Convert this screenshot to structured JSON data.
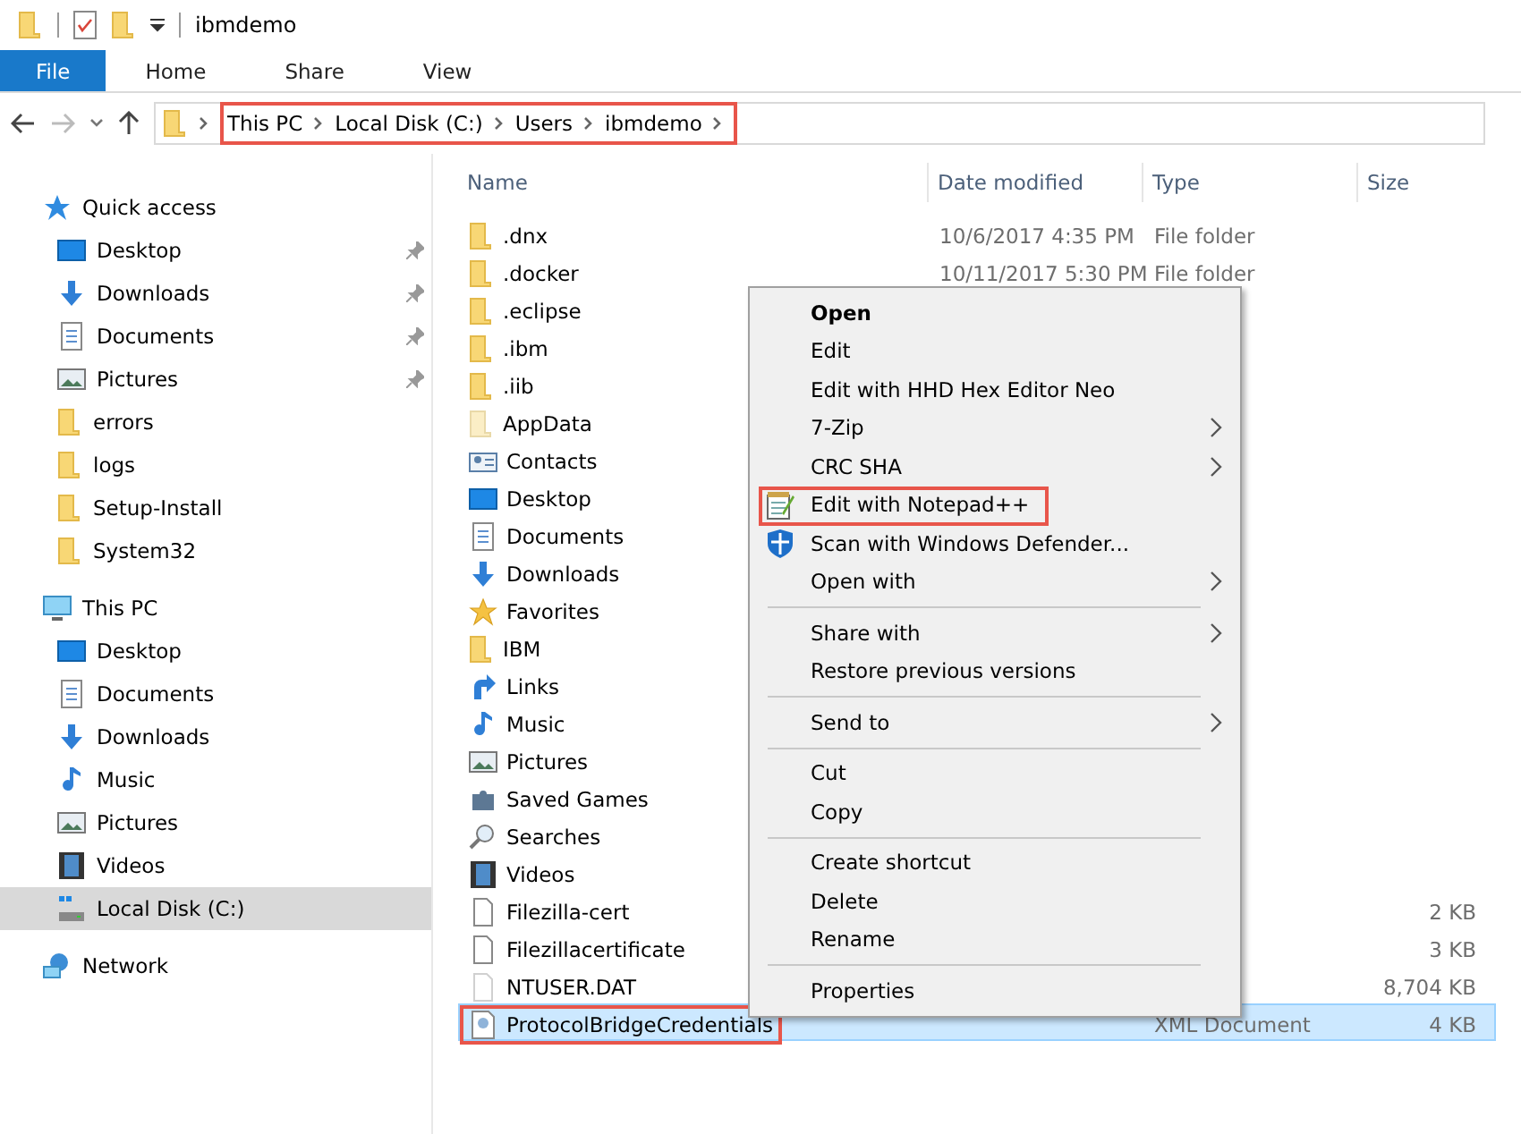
{
  "window": {
    "title": "ibmdemo"
  },
  "ribbon_tabs": [
    {
      "label": "File",
      "selected": true
    },
    {
      "label": "Home",
      "selected": false
    },
    {
      "label": "Share",
      "selected": false
    },
    {
      "label": "View",
      "selected": false
    }
  ],
  "address_bar": {
    "highlighted": true,
    "breadcrumbs": [
      "This PC",
      "Local Disk (C:)",
      "Users",
      "ibmdemo"
    ]
  },
  "sidebar": {
    "items": [
      {
        "label": "Quick access",
        "kind": "star",
        "selected": false,
        "children": [
          {
            "label": "Desktop",
            "kind": "desktop",
            "pinned": true,
            "selected": false
          },
          {
            "label": "Downloads",
            "kind": "downloads",
            "pinned": true,
            "selected": false
          },
          {
            "label": "Documents",
            "kind": "documents",
            "pinned": true,
            "selected": false
          },
          {
            "label": "Pictures",
            "kind": "pictures",
            "pinned": true,
            "selected": false
          },
          {
            "label": "errors",
            "kind": "folder",
            "pinned": false,
            "selected": false
          },
          {
            "label": "logs",
            "kind": "folder",
            "pinned": false,
            "selected": false
          },
          {
            "label": "Setup-Install",
            "kind": "folder",
            "pinned": false,
            "selected": false
          },
          {
            "label": "System32",
            "kind": "folder",
            "pinned": false,
            "selected": false
          }
        ]
      },
      {
        "label": "This PC",
        "kind": "pc",
        "selected": false,
        "children": [
          {
            "label": "Desktop",
            "kind": "desktop",
            "pinned": false,
            "selected": false
          },
          {
            "label": "Documents",
            "kind": "documents",
            "pinned": false,
            "selected": false
          },
          {
            "label": "Downloads",
            "kind": "downloads",
            "pinned": false,
            "selected": false
          },
          {
            "label": "Music",
            "kind": "music",
            "pinned": false,
            "selected": false
          },
          {
            "label": "Pictures",
            "kind": "pictures",
            "pinned": false,
            "selected": false
          },
          {
            "label": "Videos",
            "kind": "videos",
            "pinned": false,
            "selected": false
          },
          {
            "label": "Local Disk (C:)",
            "kind": "disk",
            "pinned": false,
            "selected": true
          }
        ]
      },
      {
        "label": "Network",
        "kind": "network",
        "selected": false
      }
    ]
  },
  "file_list": {
    "columns": [
      "Name",
      "Date modified",
      "Type",
      "Size"
    ],
    "rows": [
      {
        "name": ".dnx",
        "kind": "folder",
        "date": "10/6/2017 4:35 PM",
        "type": "File folder",
        "selected": false,
        "highlighted": false
      },
      {
        "name": ".docker",
        "kind": "folder",
        "date": "10/11/2017 5:30 PM",
        "type": "File folder",
        "selected": false,
        "highlighted": false
      },
      {
        "name": ".eclipse",
        "kind": "folder",
        "selected": false,
        "highlighted": false
      },
      {
        "name": ".ibm",
        "kind": "folder",
        "selected": false,
        "highlighted": false
      },
      {
        "name": ".iib",
        "kind": "folder",
        "selected": false,
        "highlighted": false
      },
      {
        "name": "AppData",
        "kind": "folder-hidden",
        "selected": false,
        "highlighted": false
      },
      {
        "name": "Contacts",
        "kind": "contacts",
        "selected": false,
        "highlighted": false
      },
      {
        "name": "Desktop",
        "kind": "desktop",
        "selected": false,
        "highlighted": false
      },
      {
        "name": "Documents",
        "kind": "documents",
        "selected": false,
        "highlighted": false
      },
      {
        "name": "Downloads",
        "kind": "downloads",
        "selected": false,
        "highlighted": false
      },
      {
        "name": "Favorites",
        "kind": "star-gold",
        "selected": false,
        "highlighted": false
      },
      {
        "name": "IBM",
        "kind": "folder",
        "selected": false,
        "highlighted": false
      },
      {
        "name": "Links",
        "kind": "links",
        "selected": false,
        "highlighted": false
      },
      {
        "name": "Music",
        "kind": "music",
        "selected": false,
        "highlighted": false
      },
      {
        "name": "Pictures",
        "kind": "pictures",
        "selected": false,
        "highlighted": false
      },
      {
        "name": "Saved Games",
        "kind": "games",
        "selected": false,
        "highlighted": false
      },
      {
        "name": "Searches",
        "kind": "search",
        "selected": false,
        "highlighted": false
      },
      {
        "name": "Videos",
        "kind": "videos",
        "selected": false,
        "highlighted": false
      },
      {
        "name": "Filezilla-cert",
        "kind": "file",
        "size": "2 KB",
        "selected": false,
        "highlighted": false
      },
      {
        "name": "Filezillacertificate",
        "kind": "file",
        "size": "3 KB",
        "selected": false,
        "highlighted": false
      },
      {
        "name": "NTUSER.DAT",
        "kind": "file-hidden",
        "size": "8,704 KB",
        "selected": false,
        "highlighted": false
      },
      {
        "name": "ProtocolBridgeCredentials",
        "kind": "xml",
        "type": "XML Document",
        "size": "4 KB",
        "selected": true,
        "highlighted": true
      }
    ]
  },
  "context_menu": {
    "items": [
      {
        "kind": "item",
        "label": "Open",
        "default": true
      },
      {
        "kind": "item",
        "label": "Edit"
      },
      {
        "kind": "item",
        "label": "Edit with HHD Hex Editor Neo"
      },
      {
        "kind": "item",
        "label": "7-Zip",
        "submenu": true
      },
      {
        "kind": "item",
        "label": "CRC SHA",
        "submenu": true
      },
      {
        "kind": "notepad-item",
        "label": "Edit with Notepad++",
        "highlighted": true
      },
      {
        "kind": "shield-item",
        "label": "Scan with Windows Defender..."
      },
      {
        "kind": "item",
        "label": "Open with",
        "submenu": true
      },
      {
        "kind": "separator"
      },
      {
        "kind": "item",
        "label": "Share with",
        "submenu": true
      },
      {
        "kind": "item",
        "label": "Restore previous versions"
      },
      {
        "kind": "separator"
      },
      {
        "kind": "item",
        "label": "Send to",
        "submenu": true
      },
      {
        "kind": "separator"
      },
      {
        "kind": "item",
        "label": "Cut"
      },
      {
        "kind": "item",
        "label": "Copy"
      },
      {
        "kind": "separator"
      },
      {
        "kind": "item",
        "label": "Create shortcut"
      },
      {
        "kind": "item",
        "label": "Delete"
      },
      {
        "kind": "item",
        "label": "Rename"
      },
      {
        "kind": "separator"
      },
      {
        "kind": "item",
        "label": "Properties"
      }
    ]
  }
}
